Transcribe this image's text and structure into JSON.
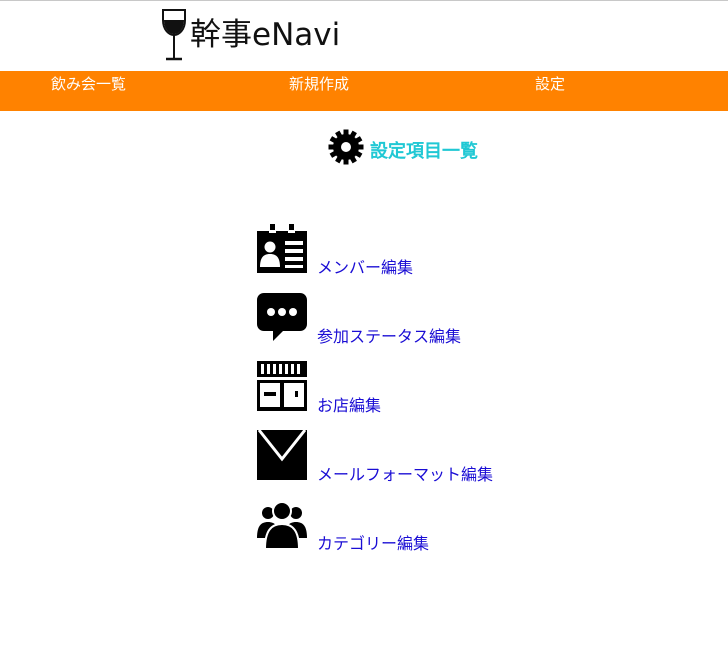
{
  "header": {
    "logo_text": "幹事eNavi"
  },
  "nav": {
    "items": [
      {
        "label": "飲み会一覧"
      },
      {
        "label": "新規作成"
      },
      {
        "label": "設定"
      }
    ]
  },
  "main": {
    "title": "設定項目一覧",
    "menu": [
      {
        "label": "メンバー編集",
        "icon": "member-card-icon"
      },
      {
        "label": "参加ステータス編集",
        "icon": "speech-bubble-icon"
      },
      {
        "label": "お店編集",
        "icon": "store-icon"
      },
      {
        "label": "メールフォーマット編集",
        "icon": "mail-icon"
      },
      {
        "label": "カテゴリー編集",
        "icon": "group-icon"
      }
    ]
  },
  "colors": {
    "nav_background": "#ff8200",
    "title": "#20c8d4",
    "link": "#1a0dd4"
  }
}
